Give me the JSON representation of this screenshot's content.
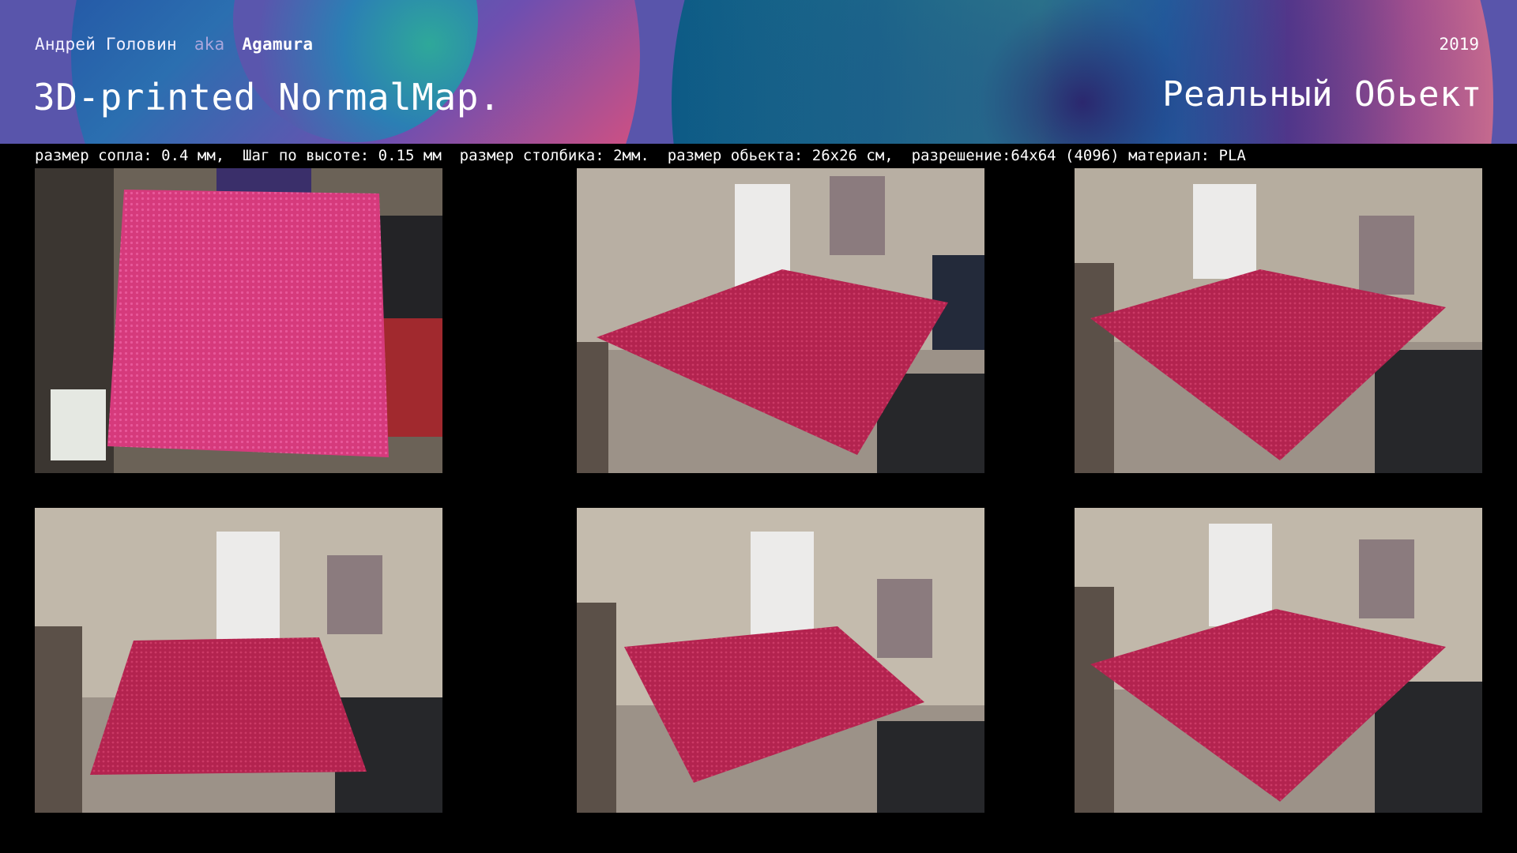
{
  "header": {
    "author_name": "Андрей Головин",
    "aka": "aka",
    "nickname": "Agamura",
    "title": "3D-printed NormalMap.",
    "year": "2019",
    "subtitle": "Реальный Обьект"
  },
  "specs": {
    "line": "размер сопла: 0.4 мм,  Шаг по высоте: 0.15 мм  размер столбика: 2мм.  размер обьекта: 26x26 см,  разрешение:64x64 (4096) материал: PLA"
  },
  "colors": {
    "background": "#000000",
    "header_base": "#5955ab",
    "object_pink": "#d63a7c",
    "object_crimson": "#b3234f"
  },
  "photos": [
    {
      "icon": "photo-top-view"
    },
    {
      "icon": "photo-angled-view"
    },
    {
      "icon": "photo-angled-view"
    },
    {
      "icon": "photo-angled-view"
    },
    {
      "icon": "photo-angled-view"
    },
    {
      "icon": "photo-angled-view"
    }
  ]
}
